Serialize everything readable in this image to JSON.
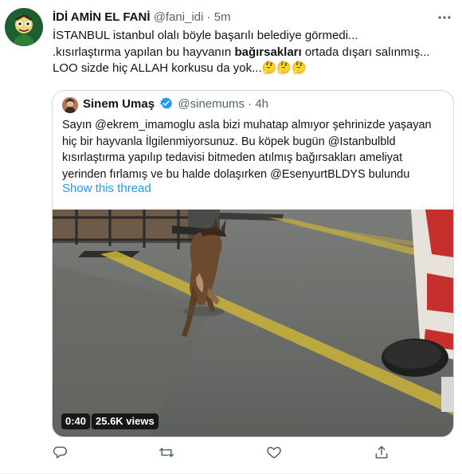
{
  "tweet": {
    "author_name": "İDİ AMİN EL FANİ",
    "author_handle": "@fani_idi",
    "separator": "·",
    "time": "5m",
    "text_line1": "İSTANBUL istanbul olalı böyle başarılı belediye görmedi...",
    "text_line2_before": ".kısırlaştırma yapılan bu hayvanın ",
    "text_line2_bold": "bağırsakları",
    "text_line2_after": " ortada dışarı salınmış...",
    "text_line3": "LOO sizde hiç ALLAH korkusu da yok...",
    "emoji": "🤔🤔🤔"
  },
  "quote": {
    "author_name": "Sinem Umaş",
    "author_handle": "@sinemums",
    "separator": "·",
    "time": "4h",
    "text_lines": [
      "Sayın @ekrem_imamoglu asla bizi muhatap almıyor şehrinizde yaşayan",
      "hiç bir hayvanla İlgilenmiyorsunuz. Bu köpek bugün  @Istanbulbld",
      "kısırlaştırma yapılıp tedavisi bitmeden atılmış bağırsakları ameliyat",
      "yerinden fırlamış ve bu halde dolaşırken @EsenyurtBLDYS bulundu"
    ],
    "show_thread": "Show this thread",
    "video": {
      "duration": "0:40",
      "views": "25.6K views"
    }
  },
  "colors": {
    "link": "#1d9bf0",
    "secondary_text": "#536471",
    "border": "#cfd9de",
    "verified": "#1d9bf0"
  },
  "icons": {
    "more": "more-horizontal-icon",
    "reply": "reply-icon",
    "retweet": "retweet-icon",
    "like": "heart-icon",
    "share": "share-icon",
    "verified": "verified-badge-icon"
  }
}
